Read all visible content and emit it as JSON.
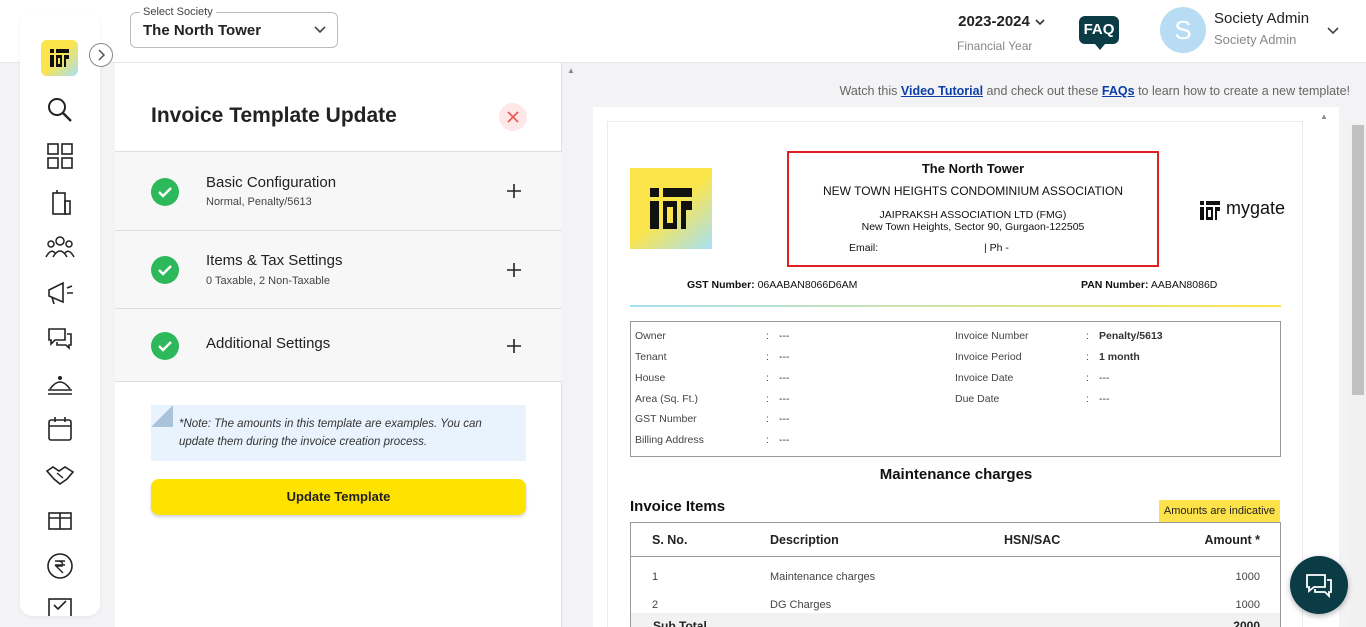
{
  "header": {
    "society_select_label": "Select Society",
    "society_select_value": "The North Tower",
    "financial_year": "2023-2024",
    "financial_year_label": "Financial Year",
    "faq_label": "FAQ",
    "avatar_initial": "S",
    "user_name": "Society Admin",
    "user_role": "Society Admin"
  },
  "sidebar": {
    "icons": [
      "search-icon",
      "dashboard-icon",
      "building-icon",
      "residents-icon",
      "announcement-icon",
      "chat-icon",
      "services-icon",
      "calendar-icon",
      "handshake-icon",
      "amenities-icon",
      "rupee-icon",
      "checklist-icon"
    ]
  },
  "panel": {
    "title": "Invoice Template Update",
    "sections": [
      {
        "title": "Basic Configuration",
        "subtitle": "Normal, Penalty/5613"
      },
      {
        "title": "Items & Tax Settings",
        "subtitle": "0 Taxable, 2 Non-Taxable"
      },
      {
        "title": "Additional Settings",
        "subtitle": ""
      }
    ],
    "note": "*Note: The amounts in this template are examples. You can update them during the invoice creation process.",
    "update_button": "Update Template"
  },
  "preview": {
    "tutorial_prefix": "Watch this",
    "tutorial_link": "Video Tutorial",
    "tutorial_middle": "and check out these",
    "faq_link": "FAQs",
    "tutorial_suffix": "to learn how to create a new template!",
    "society_name": "The North Tower",
    "association": "NEW TOWN HEIGHTS CONDOMINIUM ASSOCIATION",
    "company": "JAIPRAKSH ASSOCIATION LTD (FMG)",
    "address": "New Town Heights, Sector 90, Gurgaon-122505",
    "email_label": "Email:",
    "phone_label": "| Ph -",
    "brand": "mygate",
    "gst_label": "GST Number:",
    "gst_value": "06AABAN8066D6AM",
    "pan_label": "PAN Number:",
    "pan_value": "AABAN8086D",
    "left_details": [
      {
        "label": "Owner",
        "value": "---"
      },
      {
        "label": "Tenant",
        "value": "---"
      },
      {
        "label": "House",
        "value": "---"
      },
      {
        "label": "Area (Sq. Ft.)",
        "value": "---"
      },
      {
        "label": "GST Number",
        "value": "---"
      },
      {
        "label": "Billing Address",
        "value": "---"
      }
    ],
    "right_details": [
      {
        "label": "Invoice Number",
        "value": "Penalty/5613"
      },
      {
        "label": "Invoice Period",
        "value": "1 month"
      },
      {
        "label": "Invoice Date",
        "value": "---"
      },
      {
        "label": "Due Date",
        "value": "---"
      }
    ],
    "colon": ":",
    "maintenance_title": "Maintenance charges",
    "items_title": "Invoice Items",
    "indicative_badge": "Amounts are indicative",
    "table_headers": {
      "sno": "S. No.",
      "description": "Description",
      "hsn": "HSN/SAC",
      "amount": "Amount *"
    },
    "items": [
      {
        "sno": "1",
        "description": "Maintenance charges",
        "amount": "1000"
      },
      {
        "sno": "2",
        "description": "DG Charges",
        "amount": "1000"
      }
    ],
    "subtotal_label": "Sub Total",
    "subtotal_value": "2000"
  },
  "colors": {
    "brand_yellow": "#fee200",
    "dark_teal": "#0b3b45",
    "success_green": "#2eb85c",
    "highlight_red": "#e02020"
  }
}
